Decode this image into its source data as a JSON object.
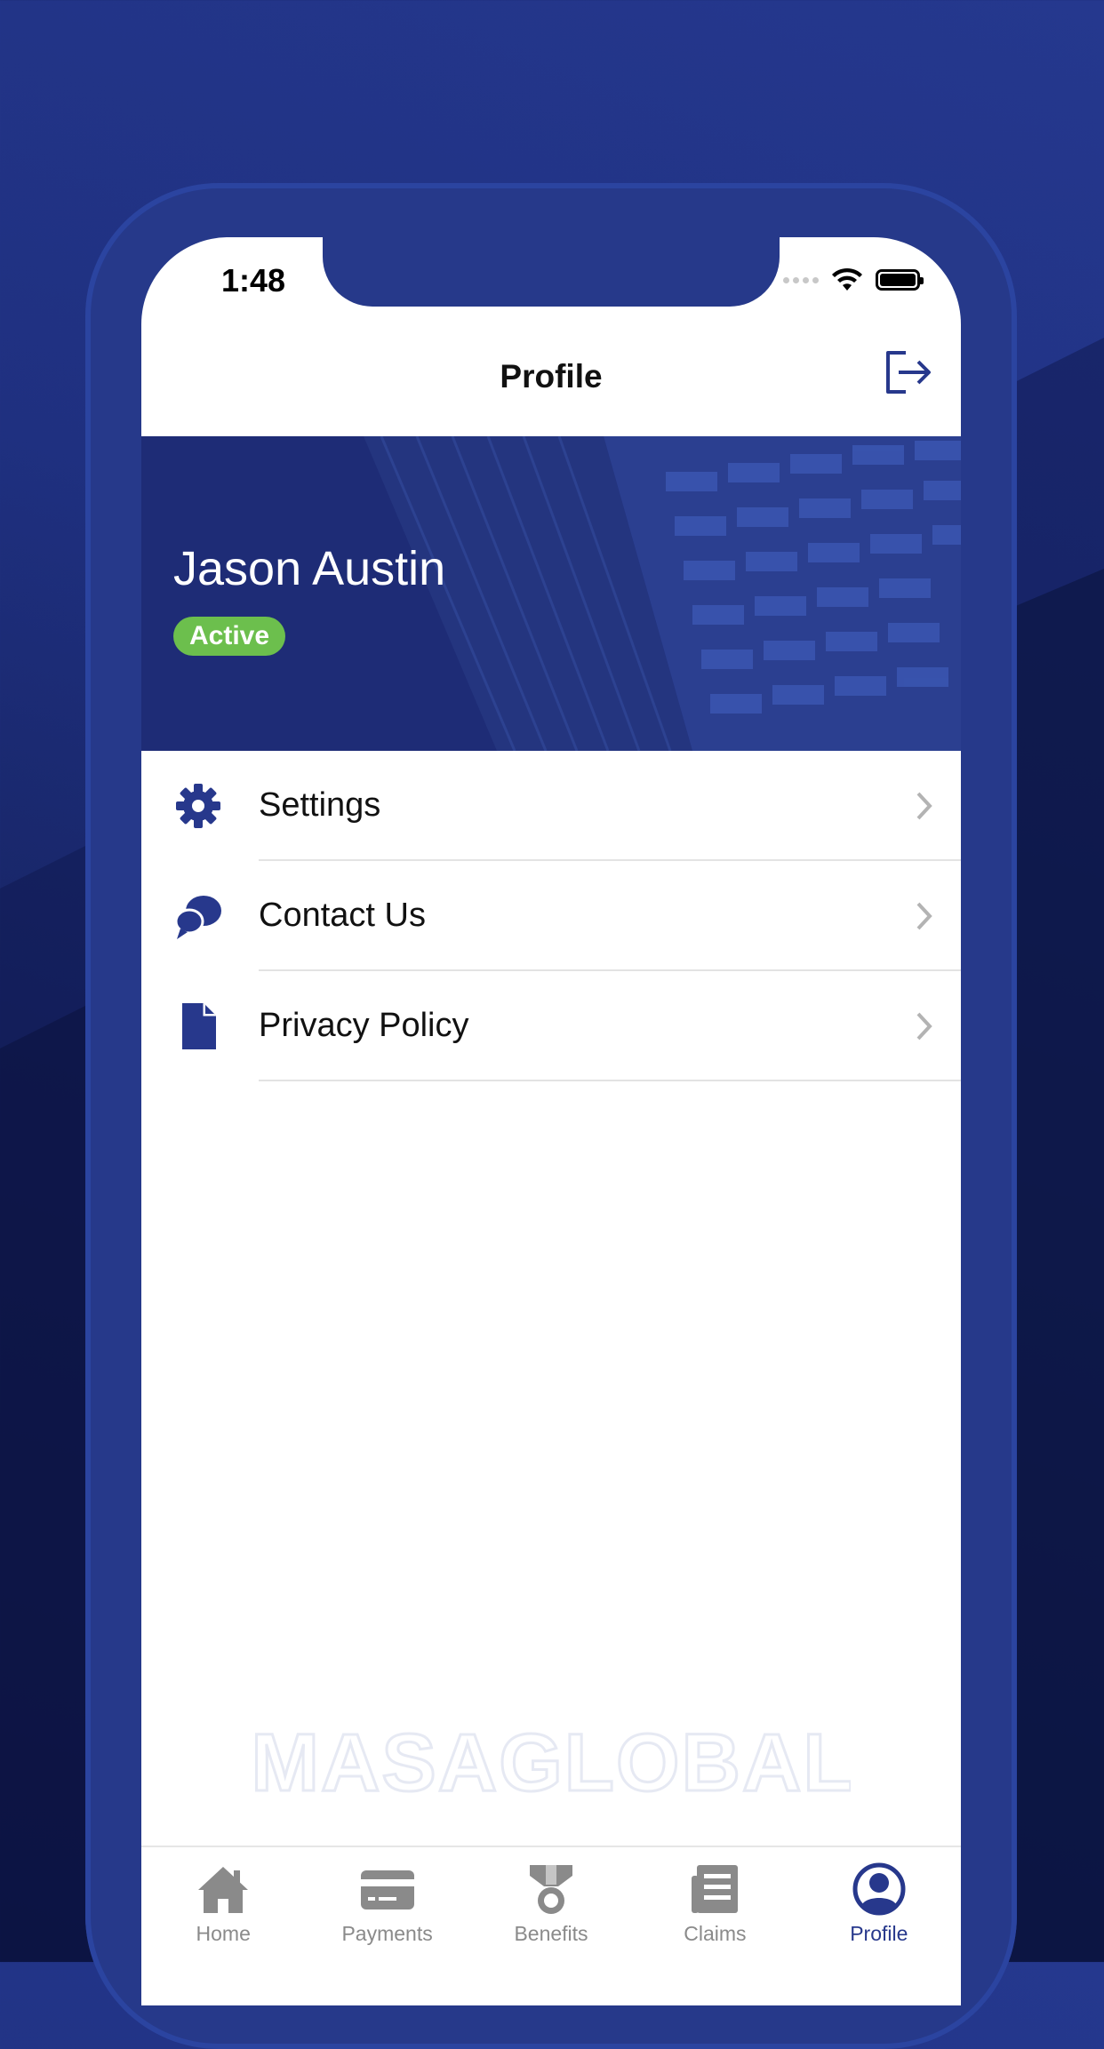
{
  "status_bar": {
    "time": "1:48"
  },
  "nav": {
    "title": "Profile"
  },
  "profile": {
    "name": "Jason Austin",
    "status": "Active"
  },
  "menu": [
    {
      "label": "Settings",
      "icon": "gear-icon"
    },
    {
      "label": "Contact Us",
      "icon": "chat-bubbles-icon"
    },
    {
      "label": "Privacy Policy",
      "icon": "document-icon"
    }
  ],
  "watermark": "MASAGLOBAL",
  "tabs": [
    {
      "label": "Home",
      "icon": "home-icon",
      "active": false
    },
    {
      "label": "Payments",
      "icon": "credit-card-icon",
      "active": false
    },
    {
      "label": "Benefits",
      "icon": "medal-icon",
      "active": false
    },
    {
      "label": "Claims",
      "icon": "news-document-icon",
      "active": false
    },
    {
      "label": "Profile",
      "icon": "user-circle-icon",
      "active": true
    }
  ],
  "colors": {
    "brand": "#27388c",
    "active_badge": "#6cbf4d",
    "tab_inactive": "#8a8a8a"
  }
}
